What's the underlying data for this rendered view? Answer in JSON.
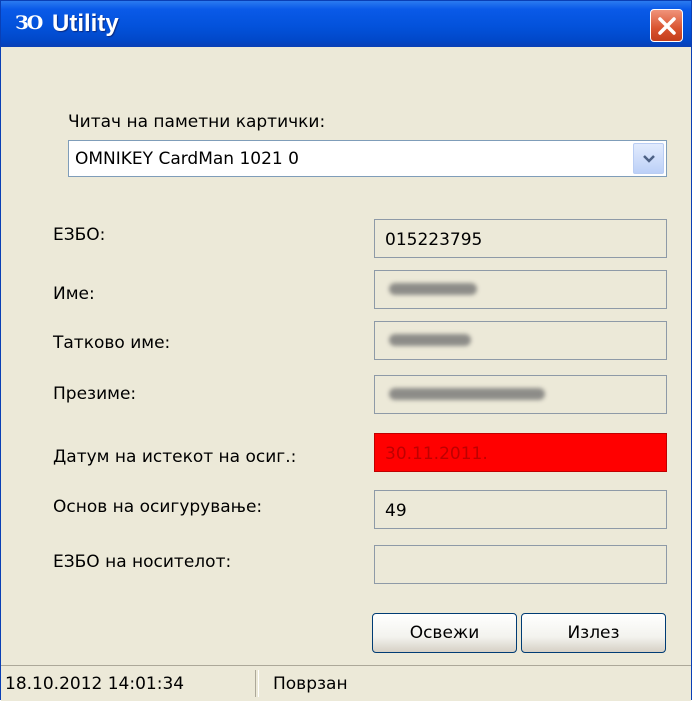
{
  "window": {
    "title": "Utility",
    "app_icon_text": "ЗО"
  },
  "reader": {
    "label": "Читач на паметни картички:",
    "selected": "OMNIKEY CardMan 1021 0"
  },
  "fields": {
    "ezbo": {
      "label": "ЕЗБО:",
      "value": "015223795"
    },
    "ime": {
      "label": "Име:",
      "value": ""
    },
    "tatkovo": {
      "label": "Татково име:",
      "value": ""
    },
    "prezime": {
      "label": "Презиме:",
      "value": ""
    },
    "datum": {
      "label": "Датум на истекот на осиг.:",
      "value": "30.11.2011."
    },
    "osnov": {
      "label": "Основ на осигурување:",
      "value": "49"
    },
    "nositel": {
      "label": "ЕЗБО на носителот:",
      "value": ""
    }
  },
  "buttons": {
    "refresh": "Освежи",
    "exit": "Излез"
  },
  "status": {
    "datetime": "18.10.2012 14:01:34",
    "state": "Поврзан"
  },
  "colors": {
    "titlebar": "#0352db",
    "window_bg": "#ece9d8",
    "expired_field": "#ff0000"
  }
}
